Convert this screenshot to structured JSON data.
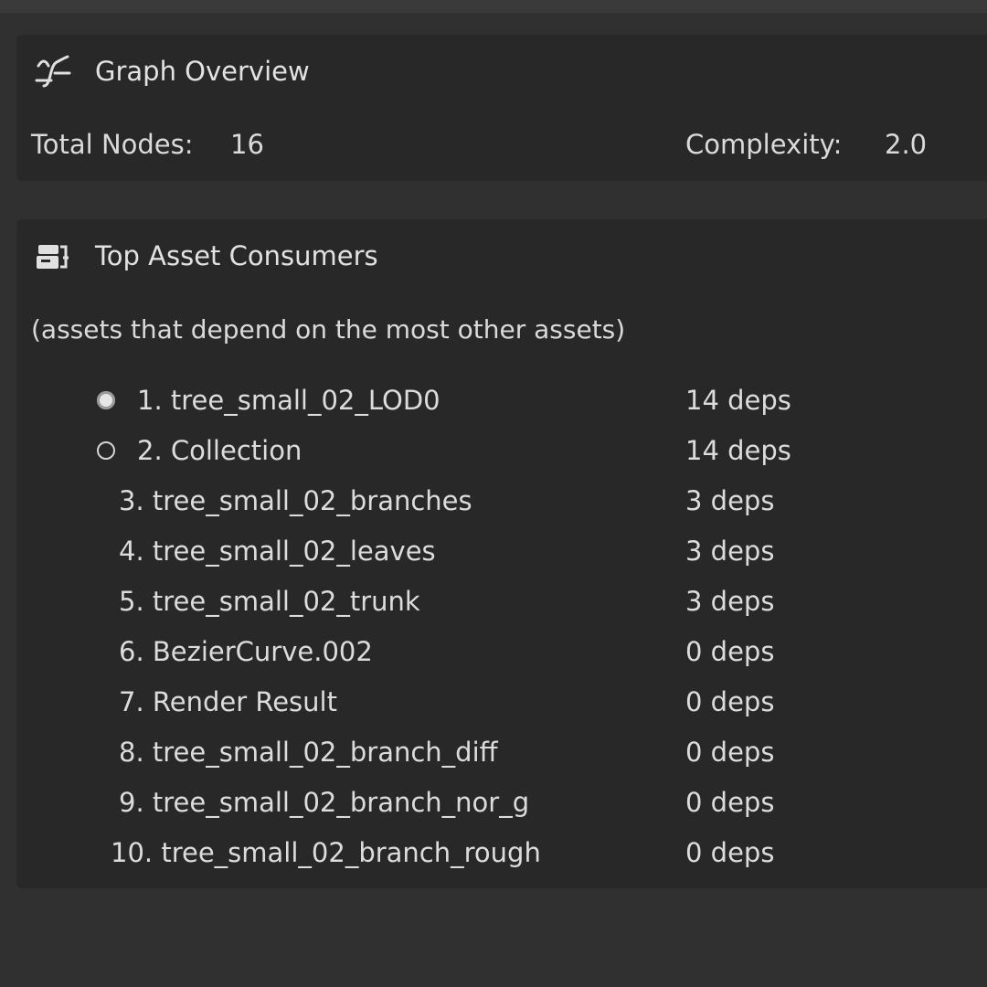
{
  "overview": {
    "title": "Graph Overview",
    "icon": "graph-curve-icon",
    "total_nodes_label": "Total Nodes:",
    "total_nodes_value": "16",
    "complexity_label": "Complexity:",
    "complexity_value": "2.0"
  },
  "consumers": {
    "title": "Top Asset Consumers",
    "icon": "asset-list-icon",
    "note": "(assets that depend on the most other assets)",
    "rows": [
      {
        "name": "1. tree_small_02_LOD0",
        "deps": "14 deps",
        "radio": "selected"
      },
      {
        "name": "2. Collection",
        "deps": "14 deps",
        "radio": "unselected"
      },
      {
        "name": "3. tree_small_02_branches",
        "deps": "3 deps",
        "radio": "none"
      },
      {
        "name": "4. tree_small_02_leaves",
        "deps": "3 deps",
        "radio": "none"
      },
      {
        "name": "5. tree_small_02_trunk",
        "deps": "3 deps",
        "radio": "none"
      },
      {
        "name": "6. BezierCurve.002",
        "deps": "0 deps",
        "radio": "none"
      },
      {
        "name": "7. Render Result",
        "deps": "0 deps",
        "radio": "none"
      },
      {
        "name": "8. tree_small_02_branch_diff",
        "deps": "0 deps",
        "radio": "none"
      },
      {
        "name": "9. tree_small_02_branch_nor_g",
        "deps": "0 deps",
        "radio": "none"
      },
      {
        "name": "10. tree_small_02_branch_rough",
        "deps": "0 deps",
        "radio": "none"
      }
    ]
  },
  "colors": {
    "background": "#303030",
    "panel": "#282828",
    "text": "#dcdcdc"
  }
}
